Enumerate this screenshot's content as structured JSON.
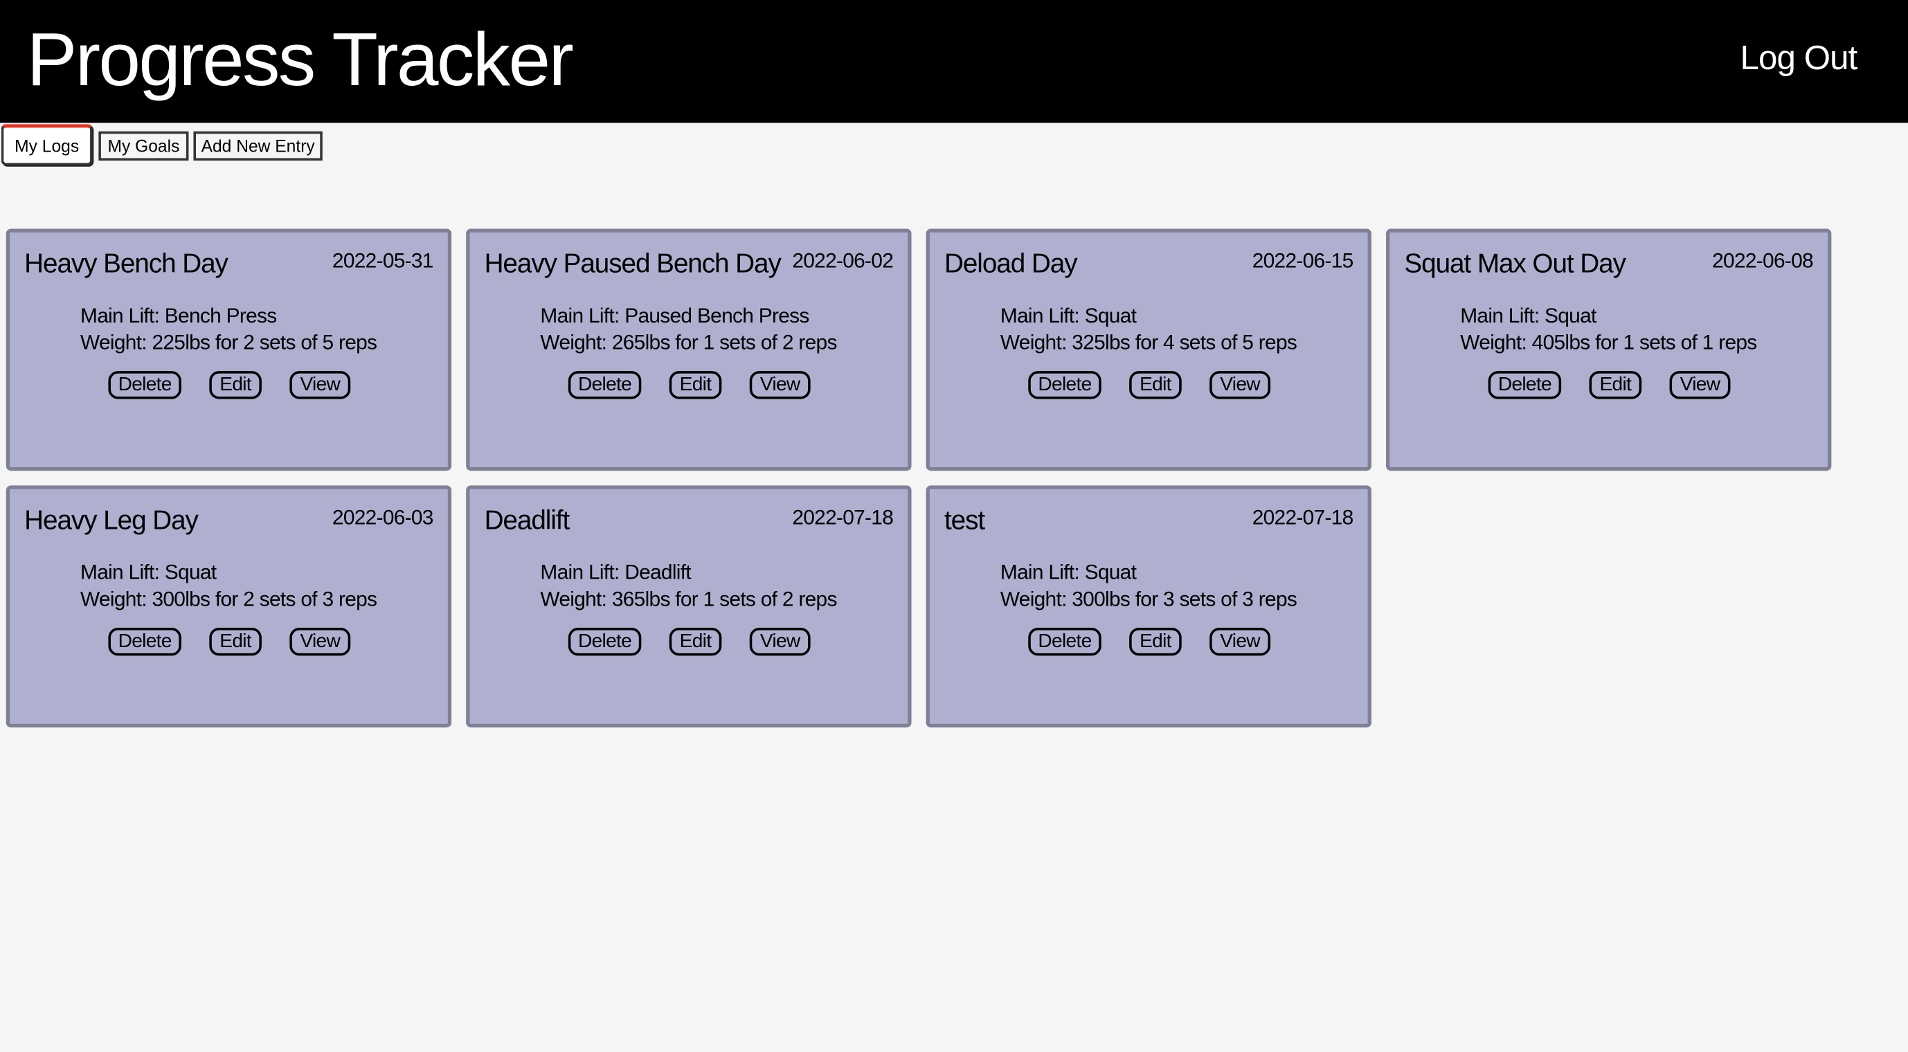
{
  "header": {
    "title": "Progress Tracker",
    "logout_label": "Log Out"
  },
  "tabs": [
    {
      "label": "My Logs",
      "active": true
    },
    {
      "label": "My Goals",
      "active": false
    },
    {
      "label": "Add New Entry",
      "active": false
    }
  ],
  "colors": {
    "header_bg": "#000000",
    "card_bg": "#afafcf",
    "card_border": "#7f7f96",
    "active_tab_accent": "#e83224"
  },
  "logs": [
    {
      "title": "Heavy Bench Day",
      "date": "2022-05-31",
      "main_lift": "Main Lift: Bench Press",
      "weight": "Weight: 225lbs for 2 sets of 5 reps"
    },
    {
      "title": "Heavy Paused Bench Day",
      "date": "2022-06-02",
      "main_lift": "Main Lift: Paused Bench Press",
      "weight": "Weight: 265lbs for 1 sets of 2 reps"
    },
    {
      "title": "Deload Day",
      "date": "2022-06-15",
      "main_lift": "Main Lift: Squat",
      "weight": "Weight: 325lbs for 4 sets of 5 reps"
    },
    {
      "title": "Squat Max Out Day",
      "date": "2022-06-08",
      "main_lift": "Main Lift: Squat",
      "weight": "Weight: 405lbs for 1 sets of 1 reps"
    },
    {
      "title": "Heavy Leg Day",
      "date": "2022-06-03",
      "main_lift": "Main Lift: Squat",
      "weight": "Weight: 300lbs for 2 sets of 3 reps"
    },
    {
      "title": "Deadlift",
      "date": "2022-07-18",
      "main_lift": "Main Lift: Deadlift",
      "weight": "Weight: 365lbs for 1 sets of 2 reps"
    },
    {
      "title": "test",
      "date": "2022-07-18",
      "main_lift": "Main Lift: Squat",
      "weight": "Weight: 300lbs for 3 sets of 3 reps"
    }
  ],
  "card_actions": {
    "delete": "Delete",
    "edit": "Edit",
    "view": "View"
  }
}
